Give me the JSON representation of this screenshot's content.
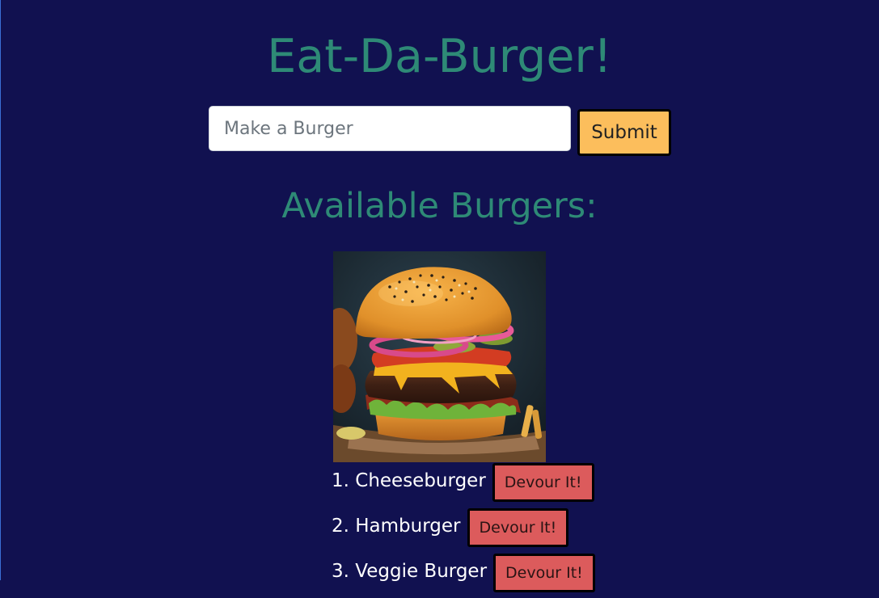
{
  "header": {
    "title": "Eat-Da-Burger!"
  },
  "form": {
    "placeholder": "Make a Burger",
    "value": "",
    "submit_label": "Submit"
  },
  "available": {
    "heading": "Available Burgers:",
    "image_alt": "burger photo",
    "items": [
      {
        "number": "1.",
        "name": "Cheeseburger",
        "button_label": "Devour It!"
      },
      {
        "number": "2.",
        "name": "Hamburger",
        "button_label": "Devour It!"
      },
      {
        "number": "3.",
        "name": "Veggie Burger",
        "button_label": "Devour It!"
      }
    ]
  },
  "colors": {
    "background": "#111150",
    "heading": "#2e8a76",
    "submit": "#fcbe5c",
    "devour": "#dc5b5c"
  }
}
